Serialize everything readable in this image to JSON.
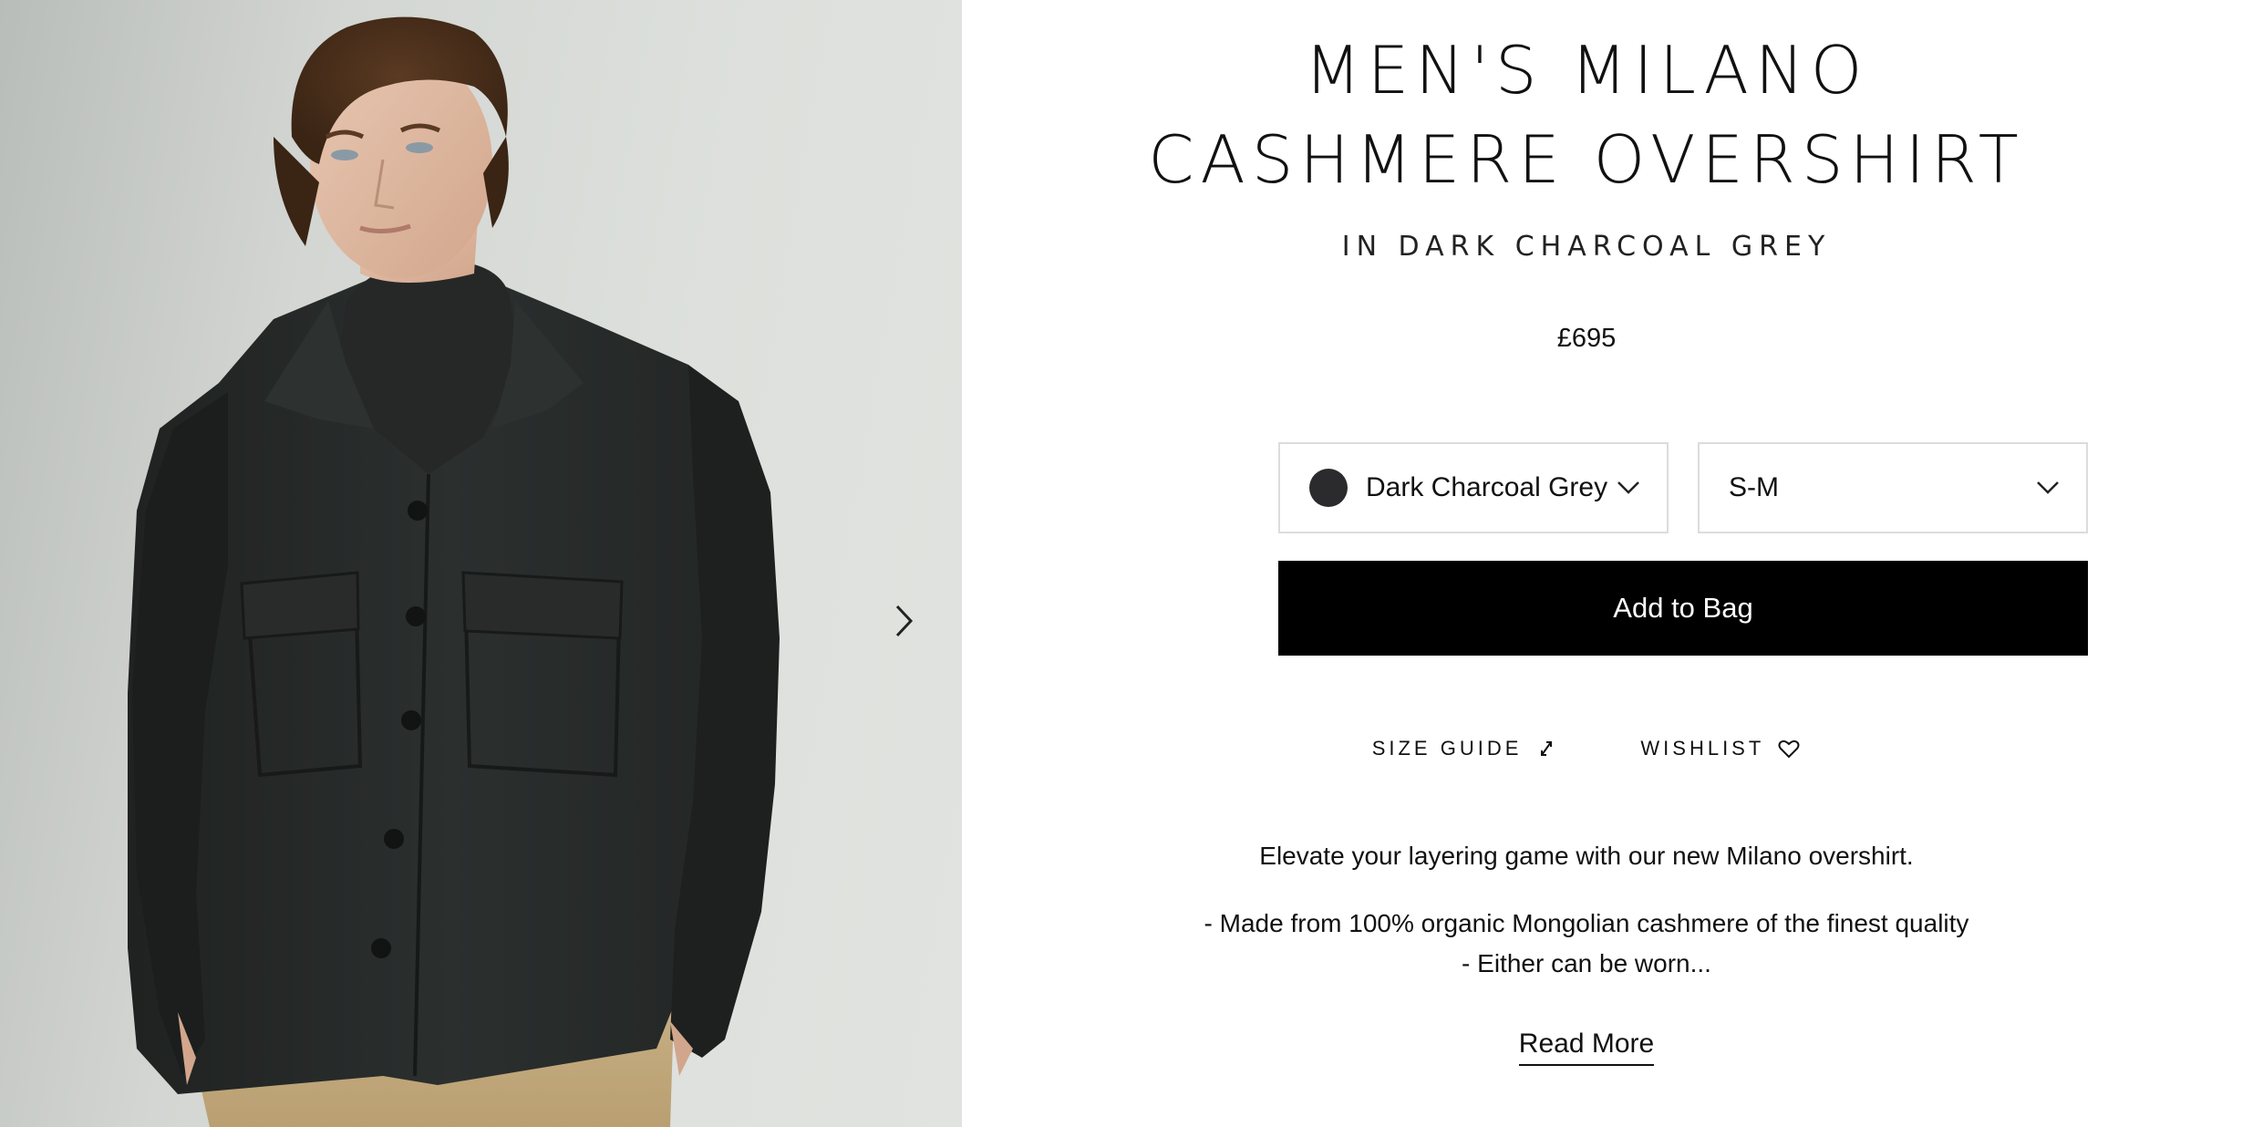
{
  "product": {
    "title_line1": "MEN'S MILANO",
    "title_line2": "CASHMERE OVERSHIRT",
    "subtitle": "IN DARK CHARCOAL GREY",
    "price": "£695"
  },
  "gallery": {
    "next_icon": "chevron-right-icon",
    "image_subject": "model-wearing-overshirt-photo"
  },
  "options": {
    "colour": {
      "selected": "Dark Charcoal Grey",
      "swatch_color": "#2b2b2d"
    },
    "size": {
      "selected": "S-M"
    }
  },
  "actions": {
    "add_to_bag": "Add to Bag",
    "size_guide": "SIZE GUIDE",
    "size_guide_icon": "expand-arrows-icon",
    "wishlist": "WISHLIST",
    "wishlist_icon": "heart-icon"
  },
  "description": {
    "lead": "Elevate your layering game with our new Milano overshirt.",
    "bullet_1": "- Made from 100% organic Mongolian cashmere of the finest quality",
    "bullet_2": "- Either can be worn...",
    "read_more": "Read More"
  },
  "colors": {
    "button_bg": "#000000",
    "button_text": "#ffffff",
    "border": "#dcdcdc"
  }
}
